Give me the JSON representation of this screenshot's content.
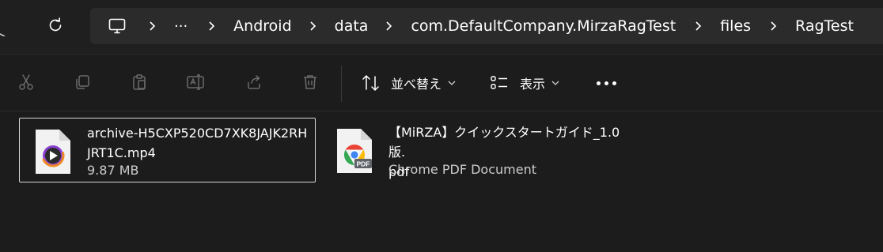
{
  "breadcrumb": {
    "items": [
      "Android",
      "data",
      "com.DefaultCompany.MirzaRagTest",
      "files",
      "RagTest"
    ],
    "overflow": "···"
  },
  "toolbar": {
    "sort_label": "並べ替え",
    "view_label": "表示"
  },
  "files": [
    {
      "name_line1": "archive-H5CXP520CD7XK8JAJK2RH",
      "name_line2": "JRT1C.mp4",
      "meta": "9.87 MB",
      "selected": true
    },
    {
      "name_line1": "【MiRZA】クイックスタートガイド_1.0版.",
      "name_line2": "pdf",
      "meta": "Chrome PDF Document",
      "icon_text": "PDF",
      "selected": false
    }
  ],
  "colors": {
    "background": "#1c1c1c",
    "address_bar": "#2b2b2b",
    "disabled_icon": "#6b6b6b",
    "chrome_red": "#ea4335",
    "chrome_yellow": "#fbbc05",
    "chrome_green": "#34a853",
    "chrome_blue": "#4285f4",
    "media_orange": "#f08a24",
    "media_purple": "#8a3fd1"
  }
}
